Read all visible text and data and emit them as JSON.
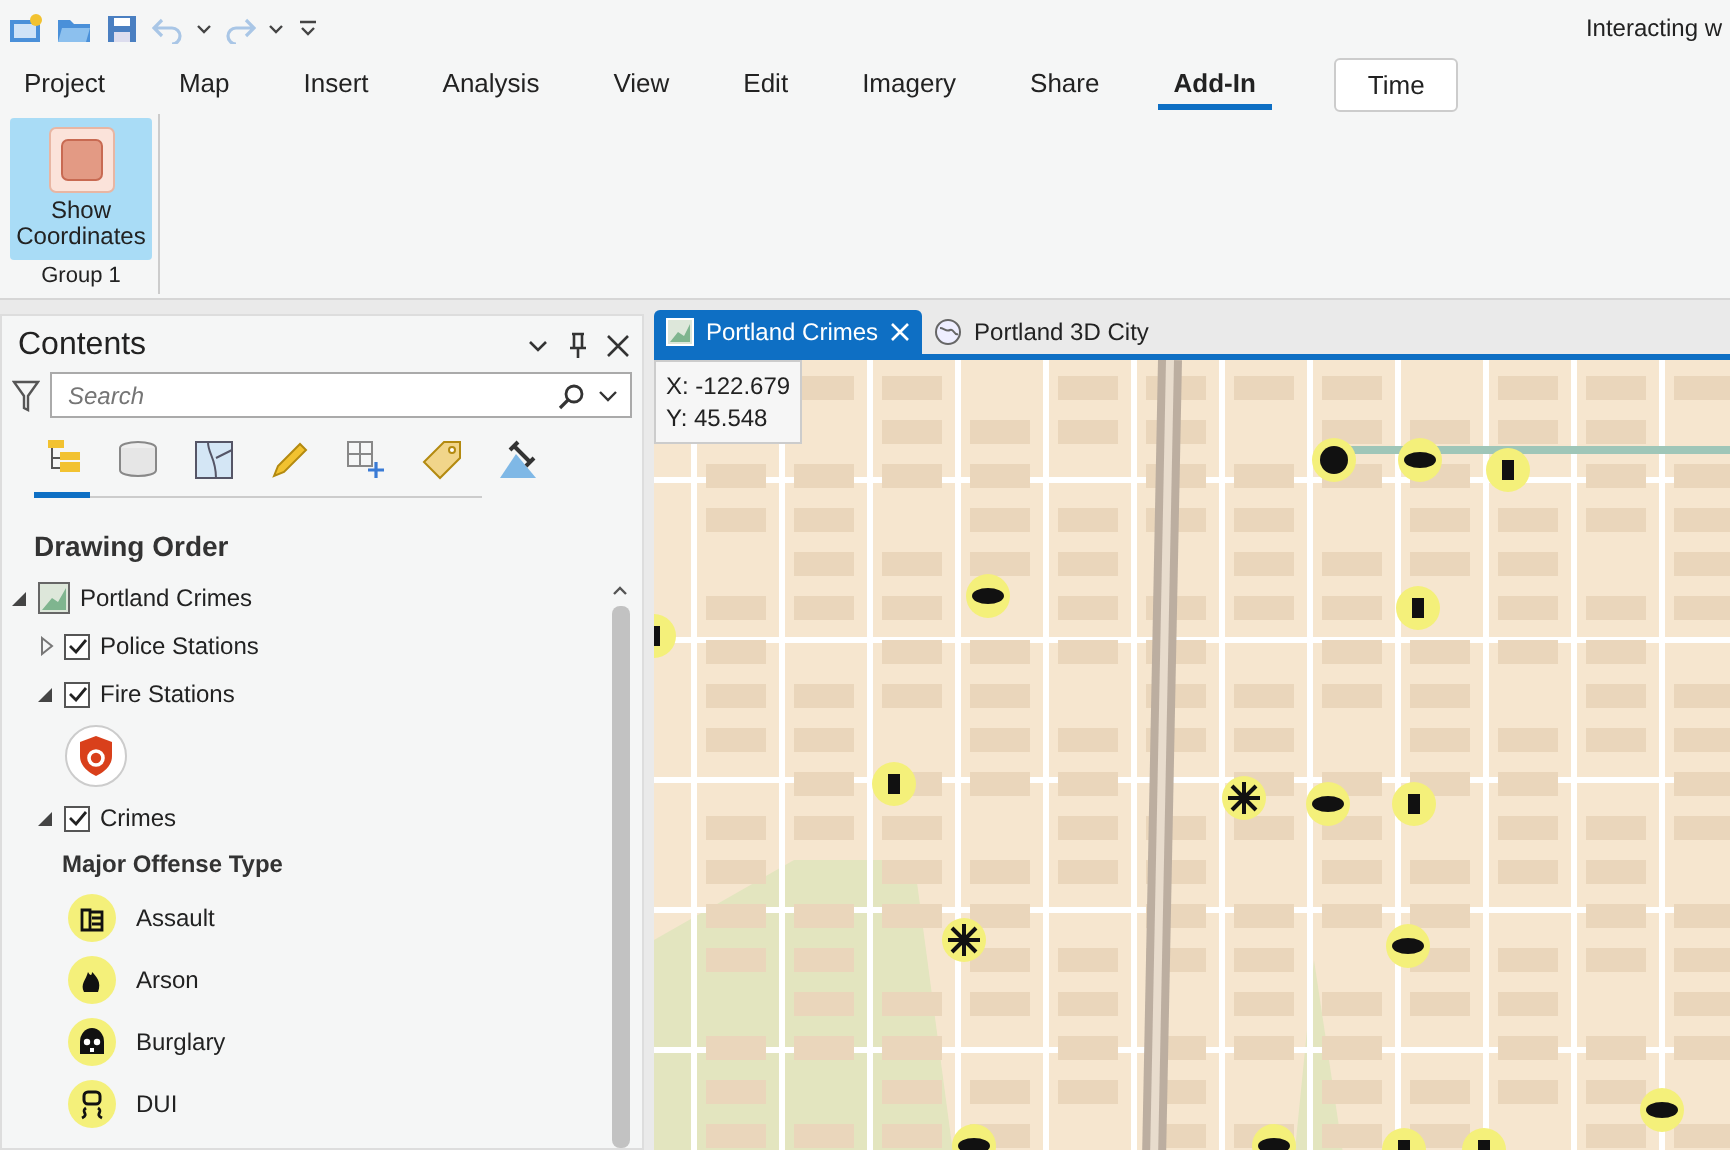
{
  "window": {
    "title": "Interacting w"
  },
  "ribbon": {
    "tabs": [
      {
        "label": "Project",
        "selected": false,
        "kind": "standard"
      },
      {
        "label": "Map",
        "selected": false,
        "kind": "standard"
      },
      {
        "label": "Insert",
        "selected": false,
        "kind": "standard"
      },
      {
        "label": "Analysis",
        "selected": false,
        "kind": "standard"
      },
      {
        "label": "View",
        "selected": false,
        "kind": "standard"
      },
      {
        "label": "Edit",
        "selected": false,
        "kind": "standard"
      },
      {
        "label": "Imagery",
        "selected": false,
        "kind": "standard"
      },
      {
        "label": "Share",
        "selected": false,
        "kind": "standard"
      },
      {
        "label": "Add-In",
        "selected": true,
        "kind": "standard"
      },
      {
        "label": "Time",
        "selected": false,
        "kind": "contextual"
      }
    ],
    "groups": [
      {
        "label": "Group 1",
        "buttons": [
          {
            "label": "Show Coordinates",
            "on": true
          }
        ]
      }
    ]
  },
  "contents": {
    "title": "Contents",
    "search": {
      "placeholder": "Search"
    },
    "views": [
      {
        "kind": "drawing-order",
        "selected": true
      },
      {
        "kind": "data-source",
        "selected": false
      },
      {
        "kind": "selection",
        "selected": false
      },
      {
        "kind": "editing",
        "selected": false
      },
      {
        "kind": "snapping",
        "selected": false
      },
      {
        "kind": "labeling",
        "selected": false
      },
      {
        "kind": "perspective",
        "selected": false
      }
    ],
    "heading": "Drawing Order",
    "tree": [
      {
        "label": "Portland Crimes",
        "kind": "map",
        "expanded": true,
        "children": [
          {
            "label": "Police Stations",
            "checked": true,
            "expanded": false
          },
          {
            "label": "Fire Stations",
            "checked": true,
            "expanded": true,
            "legend": [
              {
                "kind": "fire"
              }
            ]
          },
          {
            "label": "Crimes",
            "checked": true,
            "expanded": true,
            "legend_heading": "Major Offense Type",
            "legend": [
              {
                "kind": "assault",
                "label": "Assault"
              },
              {
                "kind": "arson",
                "label": "Arson"
              },
              {
                "kind": "burglary",
                "label": "Burglary"
              },
              {
                "kind": "dui",
                "label": "DUI"
              }
            ]
          }
        ]
      }
    ]
  },
  "map_view": {
    "tabs": [
      {
        "label": "Portland Crimes",
        "kind": "map",
        "selected": true
      },
      {
        "label": "Portland 3D City",
        "kind": "scene",
        "selected": false
      }
    ],
    "coordinates": [
      "X: -122.679",
      "Y: 45.548"
    ]
  }
}
